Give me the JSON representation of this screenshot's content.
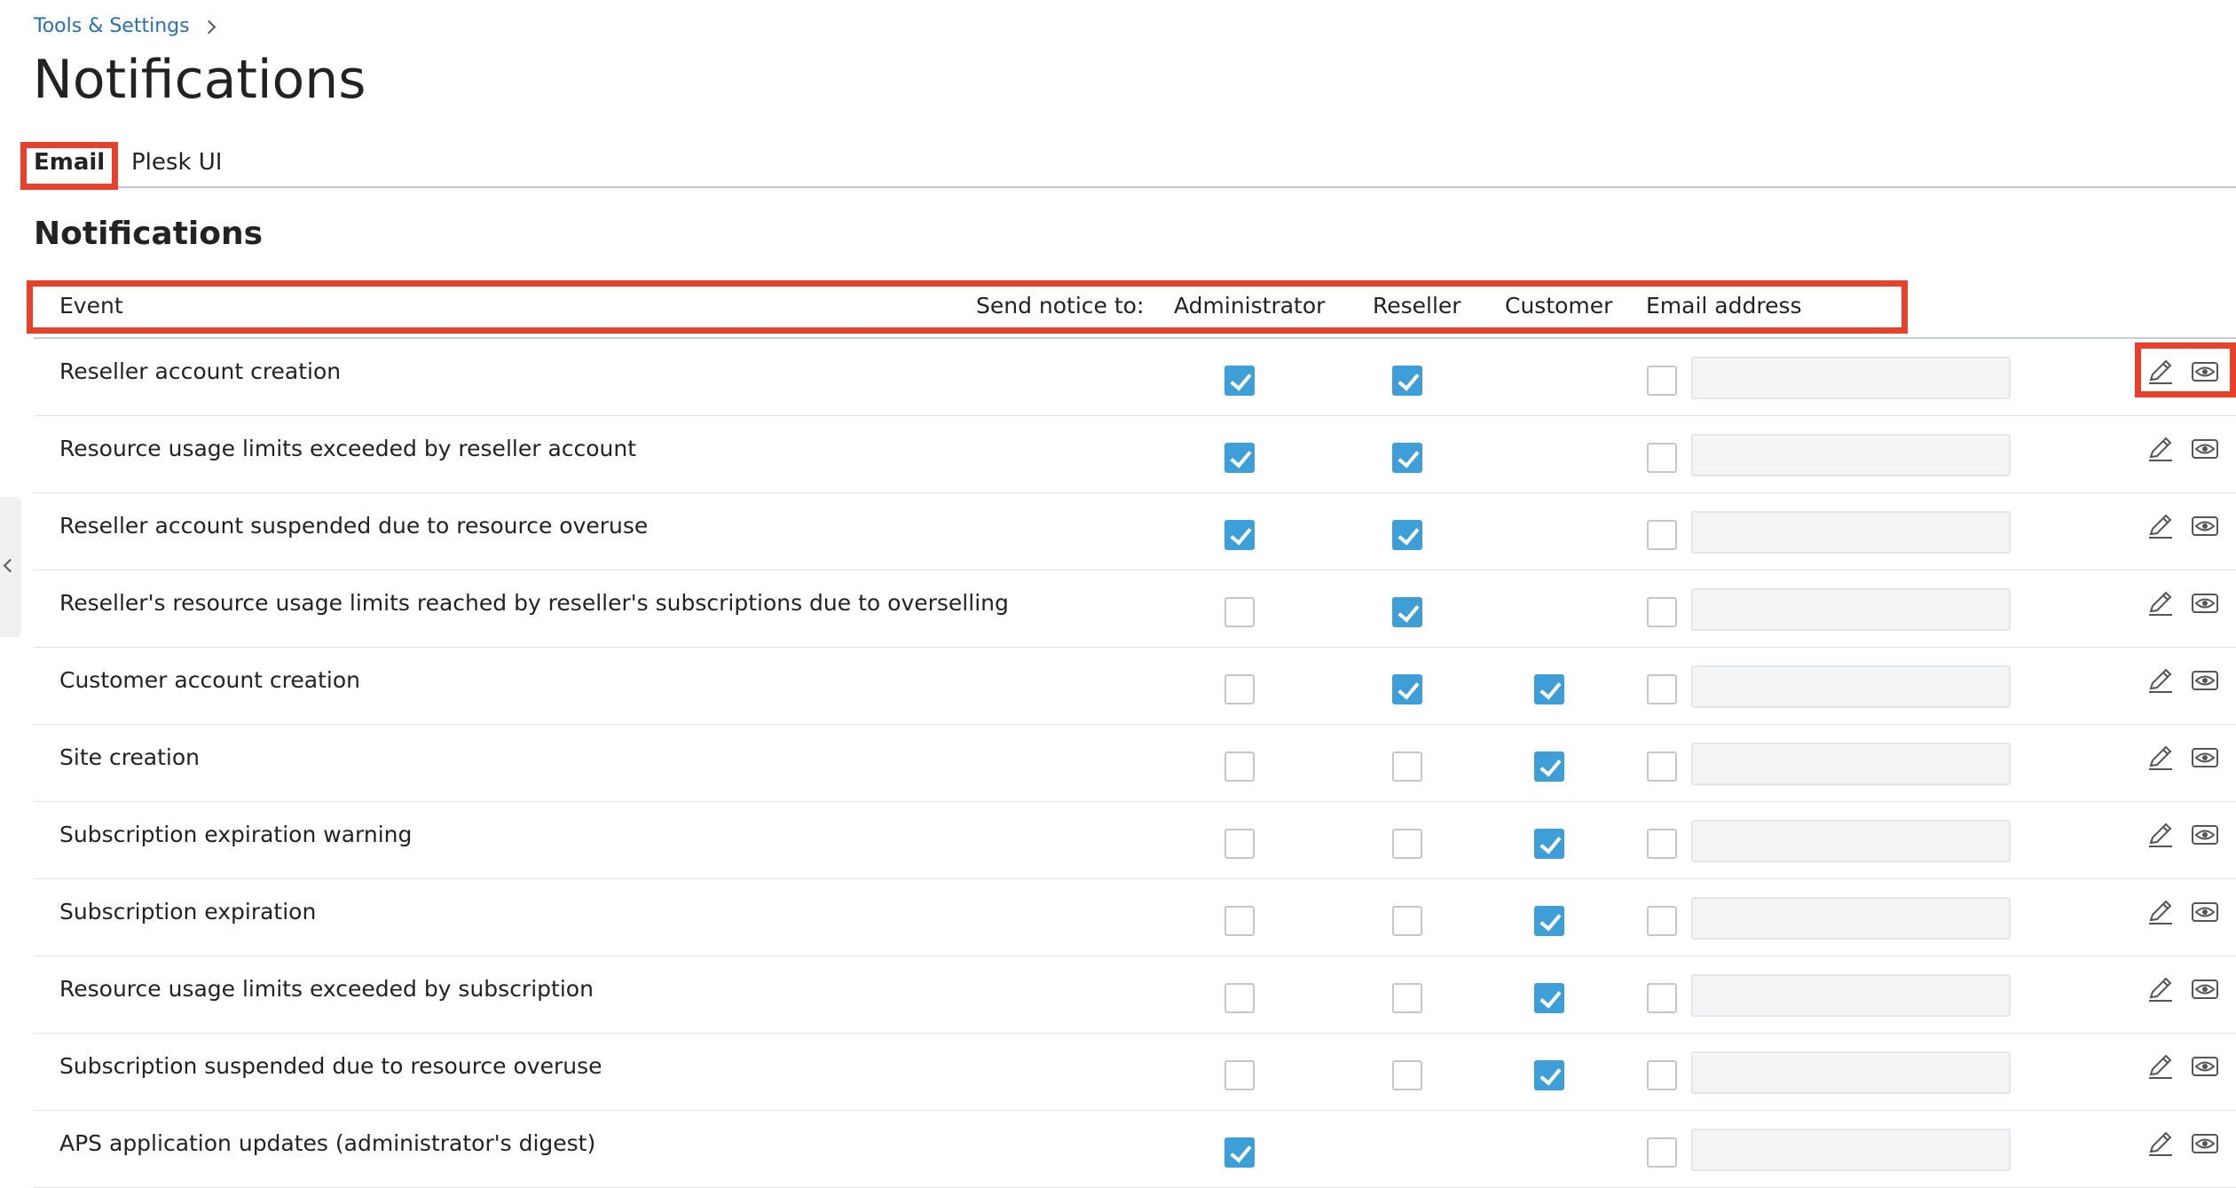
{
  "breadcrumb": {
    "parent": "Tools & Settings"
  },
  "page": {
    "title": "Notifications"
  },
  "tabs": [
    {
      "label": "Email",
      "active": true
    },
    {
      "label": "Plesk UI",
      "active": false
    }
  ],
  "section": {
    "title": "Notifications"
  },
  "table": {
    "headers": {
      "event": "Event",
      "send_notice_to": "Send notice to:",
      "administrator": "Administrator",
      "reseller": "Reseller",
      "customer": "Customer",
      "email_address": "Email address"
    },
    "rows": [
      {
        "event": "Reseller account creation",
        "administrator": true,
        "reseller": true,
        "customer": null,
        "email": false,
        "email_value": ""
      },
      {
        "event": "Resource usage limits exceeded by reseller account",
        "administrator": true,
        "reseller": true,
        "customer": null,
        "email": false,
        "email_value": ""
      },
      {
        "event": "Reseller account suspended due to resource overuse",
        "administrator": true,
        "reseller": true,
        "customer": null,
        "email": false,
        "email_value": ""
      },
      {
        "event": "Reseller's resource usage limits reached by reseller's subscriptions due to overselling",
        "administrator": false,
        "reseller": true,
        "customer": null,
        "email": false,
        "email_value": ""
      },
      {
        "event": "Customer account creation",
        "administrator": false,
        "reseller": true,
        "customer": true,
        "email": false,
        "email_value": ""
      },
      {
        "event": "Site creation",
        "administrator": false,
        "reseller": false,
        "customer": true,
        "email": false,
        "email_value": ""
      },
      {
        "event": "Subscription expiration warning",
        "administrator": false,
        "reseller": false,
        "customer": true,
        "email": false,
        "email_value": ""
      },
      {
        "event": "Subscription expiration",
        "administrator": false,
        "reseller": false,
        "customer": true,
        "email": false,
        "email_value": ""
      },
      {
        "event": "Resource usage limits exceeded by subscription",
        "administrator": false,
        "reseller": false,
        "customer": true,
        "email": false,
        "email_value": ""
      },
      {
        "event": "Subscription suspended due to resource overuse",
        "administrator": false,
        "reseller": false,
        "customer": true,
        "email": false,
        "email_value": ""
      },
      {
        "event": "APS application updates (administrator's digest)",
        "administrator": true,
        "reseller": null,
        "customer": null,
        "email": false,
        "email_value": ""
      }
    ]
  },
  "icons": {
    "edit": "pencil-icon",
    "view": "eye-icon",
    "breadcrumb_separator": "chevron-right-icon",
    "sidebar_toggle": "chevron-left-icon"
  },
  "colors": {
    "link": "#2a6fb0",
    "checkbox_checked": "#3d9ed8",
    "highlight": "#e8402b"
  }
}
